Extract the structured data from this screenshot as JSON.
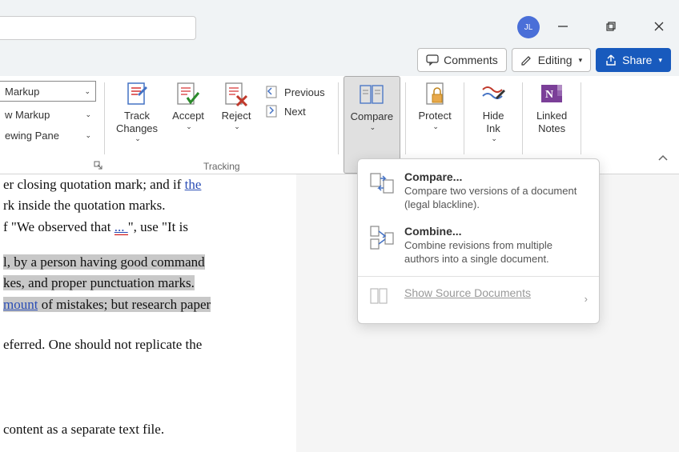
{
  "titlebar": {
    "avatar_initials": "JL"
  },
  "actions": {
    "comments": "Comments",
    "editing": "Editing",
    "share": "Share"
  },
  "ribbon": {
    "markup_select": "Markup",
    "show_markup": "w Markup",
    "reviewing_pane": "ewing Pane",
    "tracking_label": "Tracking",
    "track_changes": "Track\nChanges",
    "accept": "Accept",
    "reject": "Reject",
    "previous": "Previous",
    "next": "Next",
    "compare": "Compare",
    "protect": "Protect",
    "hide_ink": "Hide\nInk",
    "linked_notes": "Linked\nNotes"
  },
  "dropdown": {
    "compare_title": "Compare...",
    "compare_desc": "Compare two versions of a document (legal blackline).",
    "combine_title": "Combine...",
    "combine_desc": "Combine revisions from multiple authors into a single document.",
    "show_source": "Show Source Documents"
  },
  "document": {
    "line1a": "er closing quotation mark; and if ",
    "line1b": "the",
    "line2": "rk inside the quotation marks.",
    "line3a": "f \"We observed that ",
    "line3b": "... ",
    "line3c": "\", use \"It is",
    "line4": "l, by a person having good command",
    "line5": "kes, and proper punctuation marks.",
    "line6a": "mount",
    "line6b": " of mistakes; but research paper",
    "line7": "eferred. One should not replicate the",
    "line8": "content as a separate text file."
  }
}
